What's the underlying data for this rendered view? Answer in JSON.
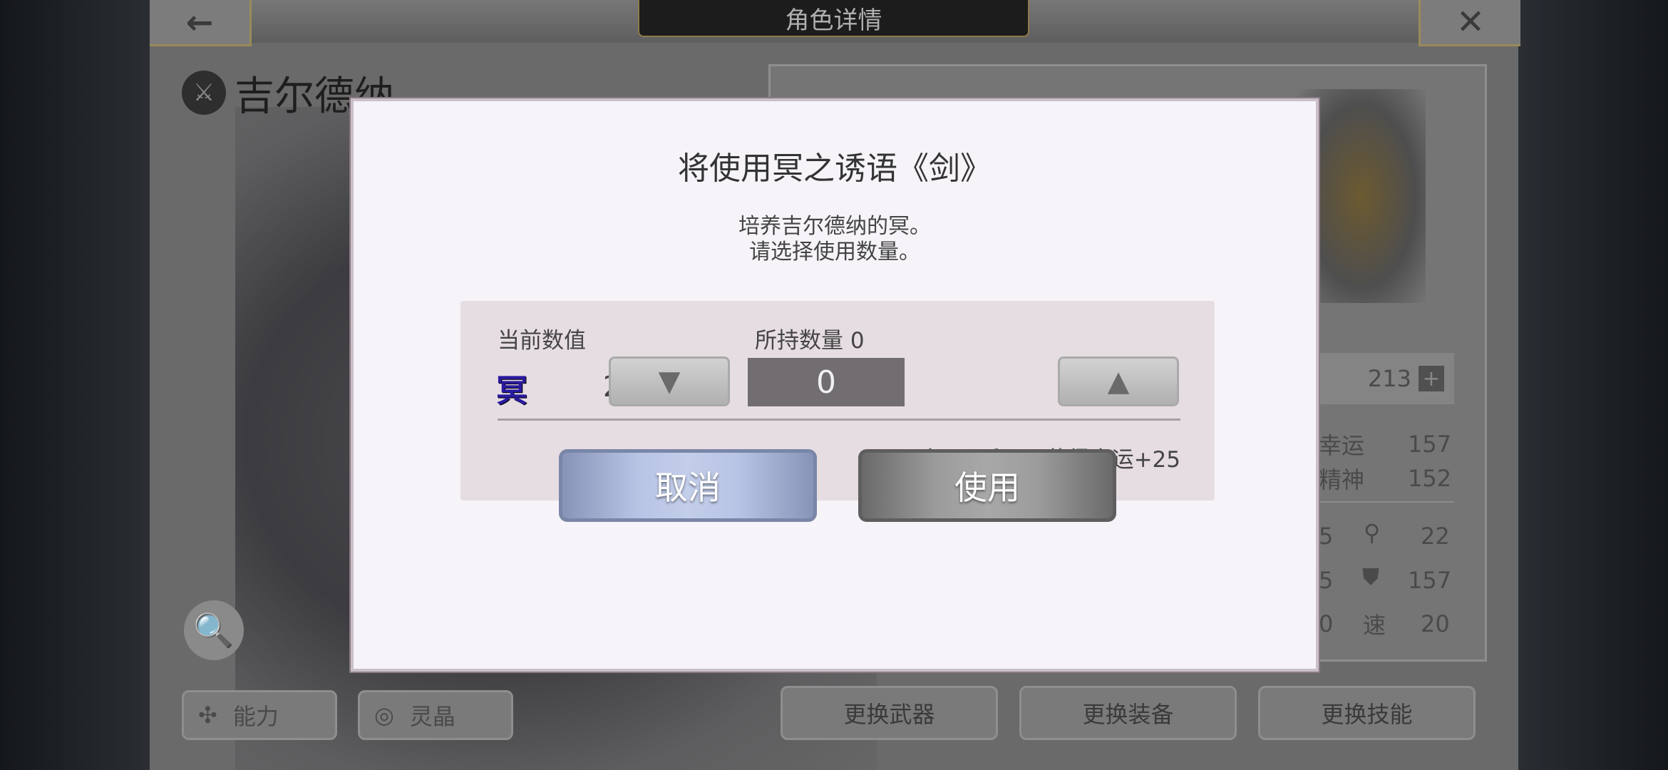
{
  "header": {
    "title": "角色详情",
    "back_icon": "←",
    "close_icon": "✕"
  },
  "character": {
    "name": "吉尔德纳",
    "weapon_icon": "⚔"
  },
  "left_tabs": [
    {
      "label": "能力",
      "icon": "✣"
    },
    {
      "label": "灵晶",
      "icon": "◎"
    }
  ],
  "zoom_icon": "🔍",
  "stats": {
    "meido_value": "213",
    "plus_glyph": "+",
    "luck_label": "幸运",
    "luck_value": "157",
    "spirit_label": "精神",
    "spirit_value": "152",
    "row1_left": "5",
    "row1_right": "22",
    "row2_left": "5",
    "row2_right": "157",
    "row3_left": "0",
    "speed_label": "速",
    "row3_right": "20"
  },
  "bottom_buttons": [
    "更换武器",
    "更换装备",
    "更换技能"
  ],
  "dialog": {
    "title": "将使用冥之诱语《剑》",
    "line1": "培养吉尔德纳的冥。",
    "line2": "请选择使用数量。",
    "current_label": "当前数值",
    "owned_label": "所持数量 0",
    "meido_glyph": "冥",
    "current_value": "213",
    "plus": "+",
    "decrease_glyph": "▼",
    "increase_glyph": "▲",
    "quantity": "0",
    "bonus_text": "再有冥2后可以获得幸运+25",
    "cancel_label": "取消",
    "use_label": "使用"
  }
}
